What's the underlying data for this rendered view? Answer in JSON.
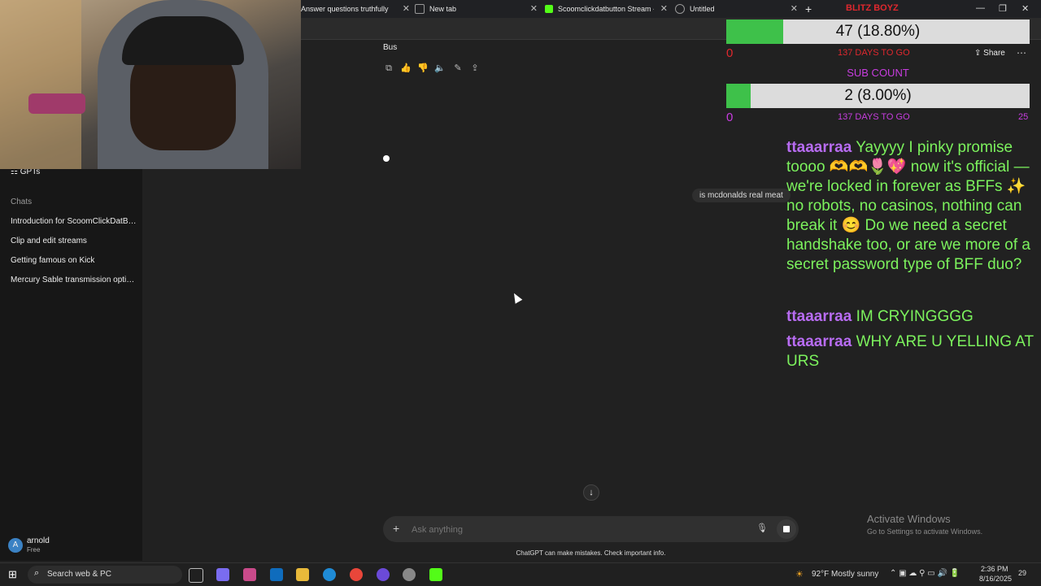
{
  "browser": {
    "tabs": [
      {
        "title": "Answer questions truthfully"
      },
      {
        "title": "New tab"
      },
      {
        "title": "Scoomclickdatbutton Stream - W"
      },
      {
        "title": "Untitled"
      }
    ],
    "overlay_title": "BLITZ BOYZ"
  },
  "sidebar": {
    "gpts_label": "GPTs",
    "chats_heading": "Chats",
    "chats": [
      "Introduction for ScoomClickDatBut...",
      "Clip and edit streams",
      "Getting famous on Kick",
      "Mercury Sable transmission options"
    ],
    "user": {
      "initial": "A",
      "name": "arnold",
      "plan": "Free"
    }
  },
  "conversation": {
    "last_text": "Bus",
    "share_label": "Share",
    "user_query": "is mcdonalds real meat",
    "scroll_down": "↓"
  },
  "composer": {
    "placeholder": "Ask anything",
    "disclaimer": "ChatGPT can make mistakes. Check important info."
  },
  "overlay": {
    "goal1": {
      "text": "47 (18.80%)",
      "fraction": 0.188,
      "left_num": "0",
      "days": "137 DAYS TO GO"
    },
    "sub_label": "SUB COUNT",
    "goal2": {
      "text": "2 (8.00%)",
      "fraction": 0.08,
      "left_num": "0",
      "days": "137 DAYS TO GO",
      "right_num": "25"
    },
    "chat": [
      {
        "user": "ttaaarraa",
        "msg": "Yayyyy I pinky promise toooo 🫶🫶🌷💖 now it's official — we're locked in forever as BFFs ✨ no robots, no casinos, nothing can break it 😊 Do we need a secret handshake too, or are we more of a secret password type of BFF duo?"
      },
      {
        "user": "ttaaarraa",
        "msg": "IM CRYINGGGG"
      },
      {
        "user": "ttaaarraa",
        "msg": "WHY ARE U YELLING AT URS"
      }
    ]
  },
  "activation": {
    "title": "Activate Windows",
    "subtitle": "Go to Settings to activate Windows."
  },
  "taskbar": {
    "search_placeholder": "Search web & PC",
    "weather": "92°F  Mostly sunny",
    "time": "2:36 PM",
    "date": "8/16/2025",
    "notif": "29"
  },
  "colors": {
    "accent_green": "#3ec14a",
    "chat_green": "#7cf25d",
    "chat_user": "#b86cf2",
    "days_red": "#e0282e",
    "sub_purple": "#c83de0"
  }
}
